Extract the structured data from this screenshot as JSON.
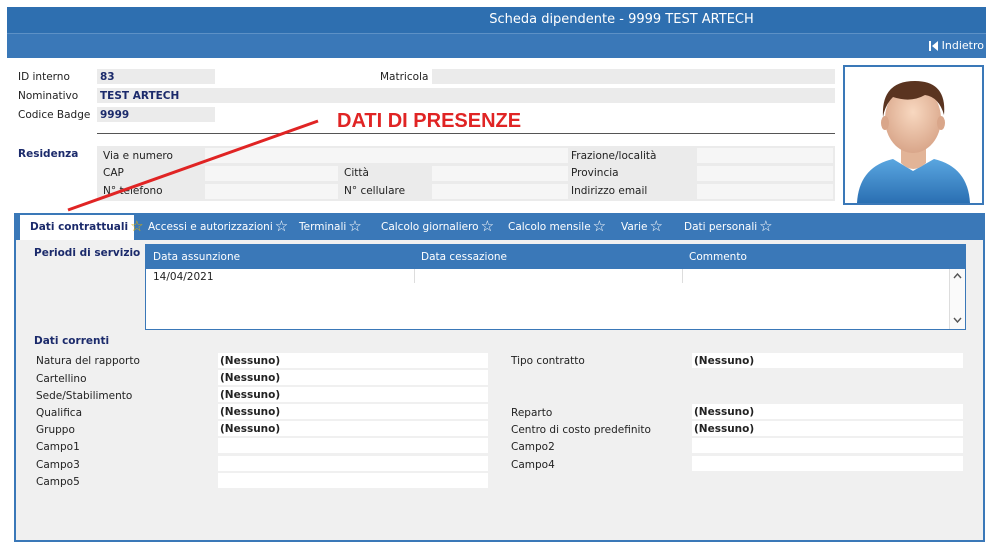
{
  "window": {
    "title": "Scheda dipendente - 9999 TEST ARTECH"
  },
  "toolbar": {
    "back_label": "Indietro"
  },
  "employee": {
    "id_label": "ID interno",
    "id_value": "83",
    "name_label": "Nominativo",
    "name_value": "TEST ARTECH",
    "badge_label": "Codice Badge",
    "badge_value": "9999",
    "matricola_label": "Matricola",
    "matricola_value": ""
  },
  "residenza": {
    "title": "Residenza",
    "via_label": "Via e numero",
    "cap_label": "CAP",
    "phone_label": "N° telefono",
    "city_label": "Città",
    "cell_label": "N° cellulare",
    "frazione_label": "Frazione/località",
    "provincia_label": "Provincia",
    "email_label": "Indirizzo email"
  },
  "annotation": "DATI DI PRESENZE",
  "tabs": [
    {
      "label": "Dati contrattuali"
    },
    {
      "label": "Accessi e autorizzazioni"
    },
    {
      "label": "Terminali"
    },
    {
      "label": "Calcolo giornaliero"
    },
    {
      "label": "Calcolo mensile"
    },
    {
      "label": "Varie"
    },
    {
      "label": "Dati personali"
    }
  ],
  "periodi": {
    "title": "Periodi di servizio",
    "columns": [
      "Data assunzione",
      "Data cessazione",
      "Commento"
    ],
    "rows": [
      {
        "assunzione": "14/04/2021",
        "cessazione": "",
        "commento": ""
      }
    ]
  },
  "dati_correnti": {
    "title": "Dati correnti",
    "natura_label": "Natura del rapporto",
    "natura_value": "(Nessuno)",
    "cartellino_label": "Cartellino",
    "cartellino_value": "(Nessuno)",
    "sede_label": "Sede/Stabilimento",
    "sede_value": "(Nessuno)",
    "qualifica_label": "Qualifica",
    "qualifica_value": "(Nessuno)",
    "gruppo_label": "Gruppo",
    "gruppo_value": "(Nessuno)",
    "campo1_label": "Campo1",
    "campo3_label": "Campo3",
    "campo5_label": "Campo5",
    "tipo_label": "Tipo contratto",
    "tipo_value": "(Nessuno)",
    "reparto_label": "Reparto",
    "reparto_value": "(Nessuno)",
    "centro_label": "Centro di costo predefinito",
    "centro_value": "(Nessuno)",
    "campo2_label": "Campo2",
    "campo4_label": "Campo4"
  },
  "colors": {
    "accent": "#3a78b8",
    "title_bar": "#2e6fb0",
    "annotation": "#e02424",
    "value_text": "#1b2a6b"
  },
  "icons": {
    "back": "skip-back-icon",
    "tab_star": "star-outline-icon",
    "photo": "person-avatar-icon"
  }
}
